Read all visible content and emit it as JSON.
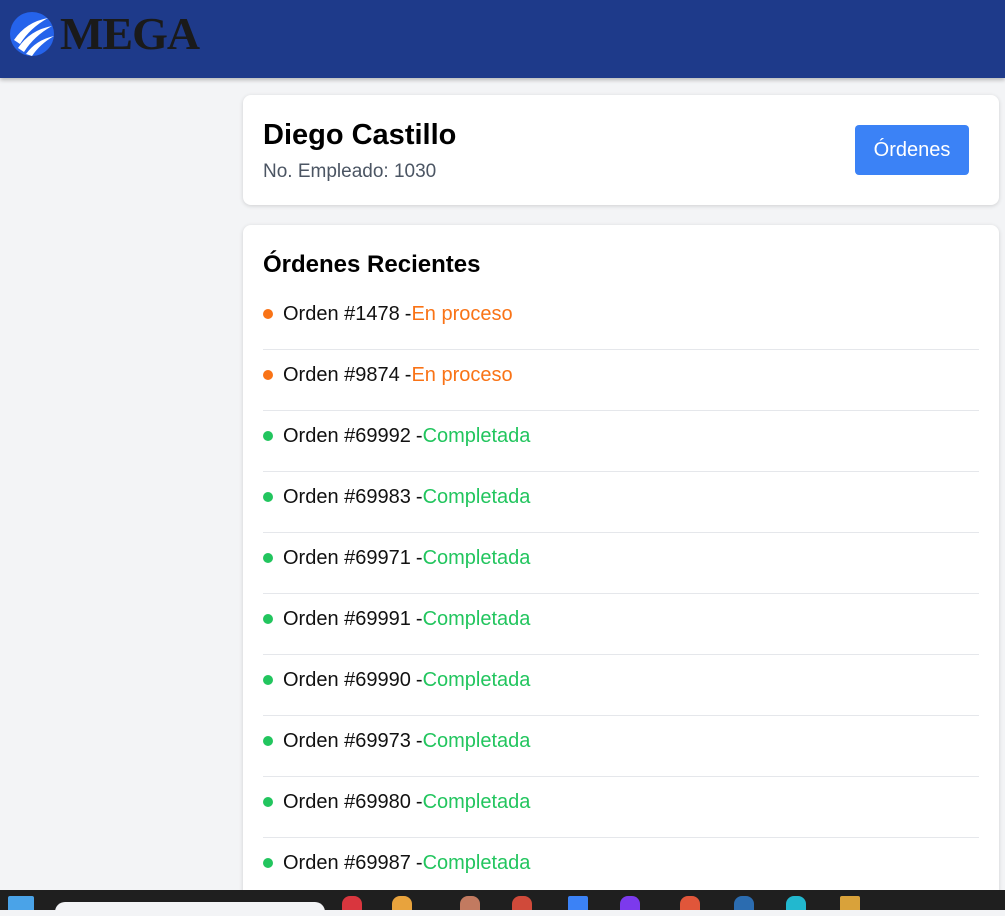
{
  "header": {
    "brand": "MEGA"
  },
  "profile": {
    "name": "Diego Castillo",
    "employee_number": "No. Empleado: 1030",
    "orders_button": "Órdenes"
  },
  "orders": {
    "title": "Órdenes Recientes",
    "separator": "-",
    "items": [
      {
        "label": "Orden #1478",
        "status": "En proceso",
        "color": "#f97316"
      },
      {
        "label": "Orden #9874",
        "status": "En proceso",
        "color": "#f97316"
      },
      {
        "label": "Orden #69992",
        "status": "Completada",
        "color": "#22c55e"
      },
      {
        "label": "Orden #69983",
        "status": "Completada",
        "color": "#22c55e"
      },
      {
        "label": "Orden #69971",
        "status": "Completada",
        "color": "#22c55e"
      },
      {
        "label": "Orden #69991",
        "status": "Completada",
        "color": "#22c55e"
      },
      {
        "label": "Orden #69990",
        "status": "Completada",
        "color": "#22c55e"
      },
      {
        "label": "Orden #69973",
        "status": "Completada",
        "color": "#22c55e"
      },
      {
        "label": "Orden #69980",
        "status": "Completada",
        "color": "#22c55e"
      },
      {
        "label": "Orden #69987",
        "status": "Completada",
        "color": "#22c55e"
      }
    ]
  },
  "colors": {
    "header_bg": "#1e3a8a",
    "button_bg": "#3b82f6",
    "in_progress": "#f97316",
    "completed": "#22c55e"
  }
}
